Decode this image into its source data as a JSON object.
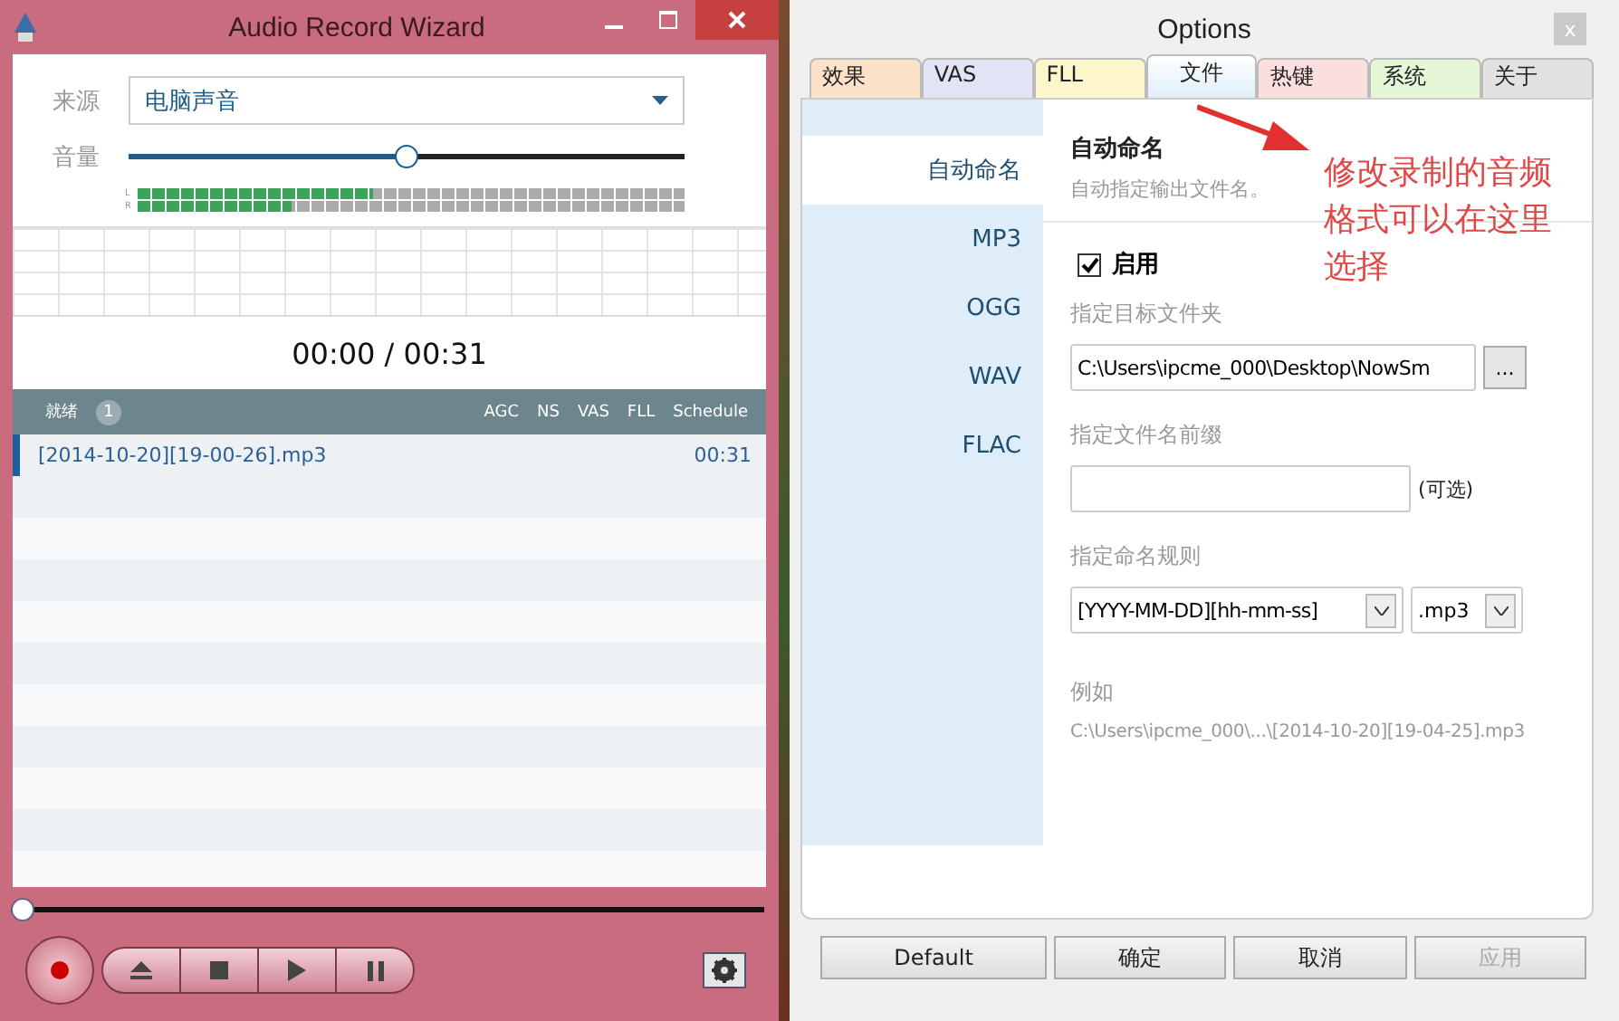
{
  "recorder": {
    "title": "Audio Record Wizard",
    "source": {
      "label": "来源",
      "value": "电脑声音"
    },
    "volume": {
      "label": "音量",
      "level": 0.5
    },
    "meters": [
      {
        "label": "L",
        "level": 0.43
      },
      {
        "label": "R",
        "level": 0.28
      }
    ],
    "time": "00:00 / 00:31",
    "list_header": {
      "status": "就绪",
      "count": "1",
      "columns": [
        "AGC",
        "NS",
        "VAS",
        "FLL",
        "Schedule"
      ]
    },
    "files": [
      {
        "name": "[2014-10-20][19-00-26].mp3",
        "duration": "00:31",
        "selected": true
      }
    ],
    "progress": {
      "level": 0
    }
  },
  "options": {
    "title": "Options",
    "close": "x",
    "tabs": [
      {
        "label": "效果",
        "color": "#fbe2c9",
        "selected": false
      },
      {
        "label": "VAS",
        "color": "#e3e3f6",
        "selected": false
      },
      {
        "label": "FLL",
        "color": "#fdf6cb",
        "selected": false
      },
      {
        "label": "文件",
        "color": "#dfeefb",
        "selected": true
      },
      {
        "label": "热键",
        "color": "#fbdede",
        "selected": false
      },
      {
        "label": "系统",
        "color": "#e5f7d7",
        "selected": false
      },
      {
        "label": "关于",
        "color": "#e2e2e2",
        "selected": false
      }
    ],
    "nav": [
      {
        "label": "自动命名",
        "selected": true
      },
      {
        "label": "MP3",
        "selected": false
      },
      {
        "label": "OGG",
        "selected": false
      },
      {
        "label": "WAV",
        "selected": false
      },
      {
        "label": "FLAC",
        "selected": false
      }
    ],
    "section_title": "自动命名",
    "section_desc": "自动指定输出文件名。",
    "enable": {
      "label": "启用",
      "checked": true
    },
    "folder": {
      "label": "指定目标文件夹",
      "value": "C:\\Users\\ipcme_000\\Desktop\\NowSm",
      "browse": "..."
    },
    "prefix": {
      "label": "指定文件名前缀",
      "hint": "(可选)"
    },
    "rule": {
      "label": "指定命名规则",
      "pattern": "[YYYY-MM-DD][hh-mm-ss]",
      "format": ".mp3"
    },
    "example": {
      "label": "例如",
      "value": "C:\\Users\\ipcme_000\\...\\[2014-10-20][19-04-25].mp3"
    },
    "buttons": [
      {
        "label": "Default",
        "disabled": false
      },
      {
        "label": "确定",
        "disabled": false
      },
      {
        "label": "取消",
        "disabled": false
      },
      {
        "label": "应用",
        "disabled": true
      }
    ]
  },
  "annotation": "修改录制的音频格式可以在这里选择"
}
